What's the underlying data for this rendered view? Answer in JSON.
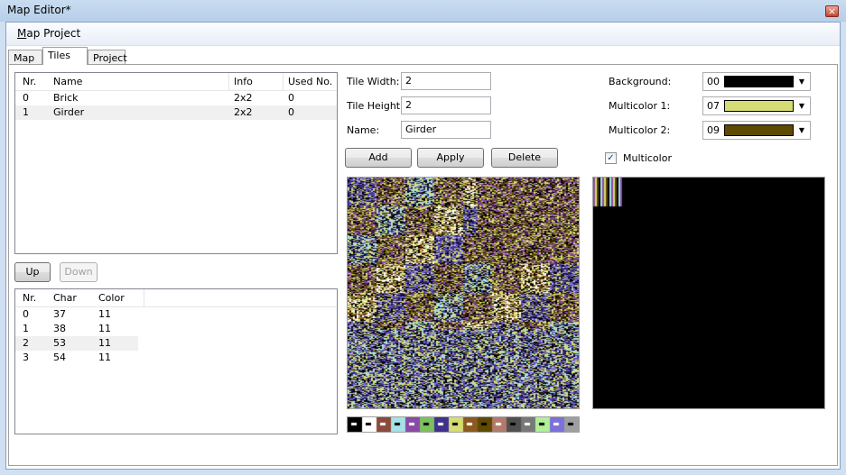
{
  "window": {
    "title": "Map Editor*",
    "close_glyph": "×"
  },
  "menu": {
    "project_label": "Map Project"
  },
  "tabs": [
    {
      "label": "Map"
    },
    {
      "label": "Tiles"
    },
    {
      "label": "Project"
    }
  ],
  "tiles_list": {
    "columns": [
      "Nr.",
      "Name",
      "Info",
      "Used No."
    ],
    "rows": [
      {
        "nr": "0",
        "name": "Brick",
        "info": "2x2",
        "used": "0"
      },
      {
        "nr": "1",
        "name": "Girder",
        "info": "2x2",
        "used": "0"
      }
    ]
  },
  "reorder": {
    "up_label": "Up",
    "down_label": "Down"
  },
  "chars_list": {
    "columns": [
      "Nr.",
      "Char",
      "Color"
    ],
    "rows": [
      {
        "nr": "0",
        "char": "37",
        "color": "11"
      },
      {
        "nr": "1",
        "char": "38",
        "color": "11"
      },
      {
        "nr": "2",
        "char": "53",
        "color": "11"
      },
      {
        "nr": "3",
        "char": "54",
        "color": "11"
      }
    ]
  },
  "tile_props": {
    "width_label": "Tile Width:",
    "width_value": "2",
    "height_label": "Tile Height:",
    "height_value": "2",
    "name_label": "Name:",
    "name_value": "Girder"
  },
  "actions": {
    "add_label": "Add",
    "apply_label": "Apply",
    "delete_label": "Delete"
  },
  "colors": {
    "background": {
      "label": "Background:",
      "value": "00",
      "swatch": "#000000"
    },
    "multicolor1": {
      "label": "Multicolor 1:",
      "value": "07",
      "swatch": "#d6dc74"
    },
    "multicolor2": {
      "label": "Multicolor 2:",
      "value": "09",
      "swatch": "#5e4a00"
    }
  },
  "multicolor": {
    "label": "Multicolor",
    "checked": true,
    "check_glyph": "✓"
  },
  "icons": {
    "dropdown": "chevron-down-icon",
    "close": "close-icon",
    "check": "check-icon"
  },
  "palette": [
    "#000000",
    "#ffffff",
    "#8b4a3a",
    "#a6e2e8",
    "#8b4aa6",
    "#7cc05e",
    "#40318d",
    "#d6dc74",
    "#8b5a20",
    "#5e4a00",
    "#b27a6a",
    "#505050",
    "#787878",
    "#b0f09a",
    "#7c70da",
    "#9f9f9f"
  ]
}
